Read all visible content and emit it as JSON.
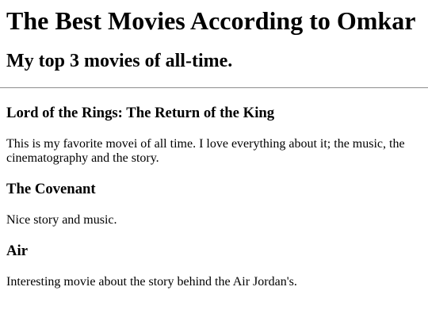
{
  "header": {
    "title": "The Best Movies According to Omkar",
    "subtitle": "My top 3 movies of all-time."
  },
  "movies": [
    {
      "title": "Lord of the Rings: The Return of the King",
      "description": "This is my favorite movei of all time. I love everything about it; the music, the cinematography and the story."
    },
    {
      "title": "The Covenant",
      "description": "Nice story and music."
    },
    {
      "title": "Air",
      "description": "Interesting movie about the story behind the Air Jordan's."
    }
  ]
}
